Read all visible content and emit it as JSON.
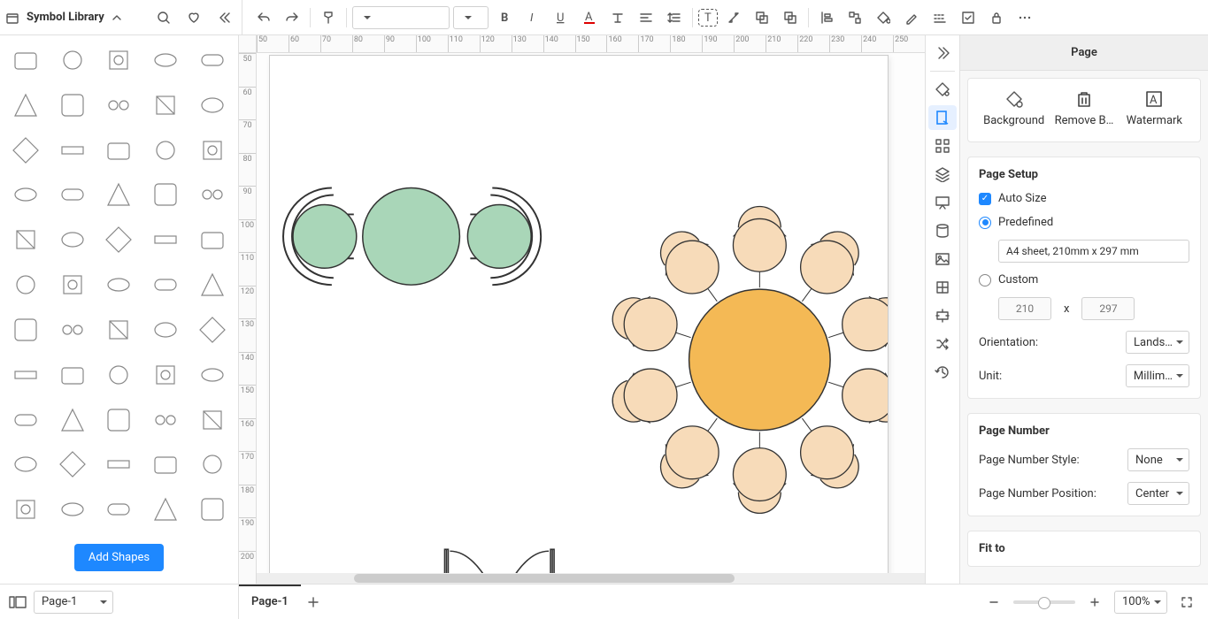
{
  "sidebar": {
    "title": "Symbol Library",
    "add_shapes_label": "Add Shapes",
    "shape_count": 55
  },
  "toolbar": {
    "font_family_placeholder": "",
    "font_size_placeholder": ""
  },
  "ruler_h": [
    "50",
    "60",
    "70",
    "80",
    "90",
    "100",
    "110",
    "120",
    "130",
    "140",
    "150",
    "160",
    "170",
    "180",
    "190",
    "200",
    "210",
    "220",
    "230",
    "240",
    "250"
  ],
  "ruler_v": [
    "50",
    "60",
    "70",
    "80",
    "90",
    "100",
    "110",
    "120",
    "130",
    "140",
    "150",
    "160",
    "170",
    "180",
    "190",
    "200"
  ],
  "canvas": {
    "green_group_color": "#a9d6b8",
    "orange_table_color": "#f4b955",
    "chair_color": "#f7dbb9"
  },
  "rightbar": {
    "tabs": [
      "collapse",
      "theme",
      "size",
      "components",
      "layers",
      "present",
      "data",
      "image",
      "grid",
      "align",
      "shuffle",
      "history"
    ],
    "active_tab_index": 2
  },
  "panel": {
    "title": "Page",
    "actions": {
      "background": "Background",
      "remove_bg": "Remove B…",
      "watermark": "Watermark"
    },
    "page_setup_title": "Page Setup",
    "auto_size_label": "Auto Size",
    "auto_size_checked": true,
    "predefined_label": "Predefined",
    "predefined_checked": true,
    "predefined_value": "A4 sheet, 210mm x 297 mm",
    "custom_label": "Custom",
    "custom_checked": false,
    "custom_w_placeholder": "210",
    "custom_h_placeholder": "297",
    "dimension_sep": "x",
    "orientation_label": "Orientation:",
    "orientation_value": "Lands…",
    "unit_label": "Unit:",
    "unit_value": "Millim…",
    "page_number_title": "Page Number",
    "pn_style_label": "Page Number Style:",
    "pn_style_value": "None",
    "pn_pos_label": "Page Number Position:",
    "pn_pos_value": "Center",
    "fit_to_title": "Fit to"
  },
  "status": {
    "page_dropdown": "Page-1",
    "tab_label": "Page-1",
    "zoom_label": "100%"
  }
}
